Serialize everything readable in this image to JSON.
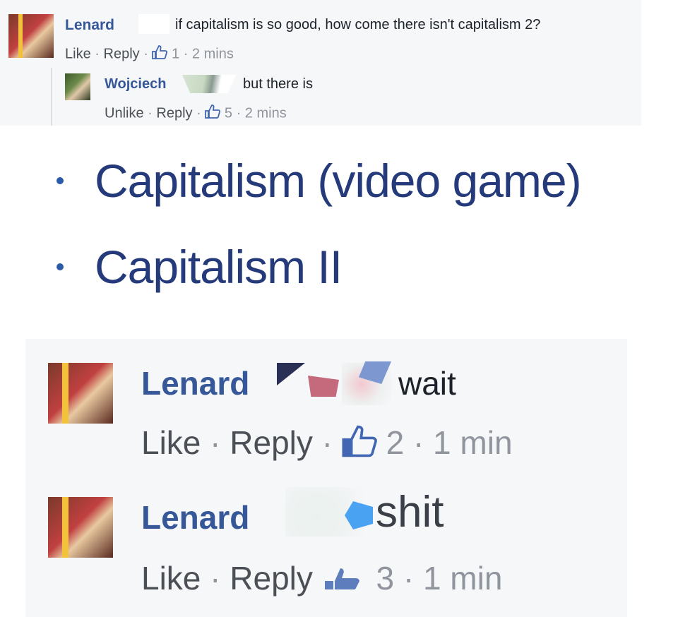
{
  "comment1": {
    "author": "Lenard",
    "text": "if capitalism is so good, how come there isn't capitalism 2?",
    "like": "Like",
    "reply": "Reply",
    "likes": "1",
    "time": "2 mins",
    "sep": "·"
  },
  "reply1": {
    "author": "Wojciech",
    "text": "but there is",
    "like": "Unlike",
    "reply": "Reply",
    "likes": "5",
    "time": "2 mins",
    "sep": "·"
  },
  "wiki": {
    "items": [
      "Capitalism (video game)",
      "Capitalism II"
    ]
  },
  "comment2": {
    "author": "Lenard",
    "text": "wait",
    "like": "Like",
    "reply": "Reply",
    "likes": "2",
    "time": "1 min",
    "sep": "·"
  },
  "comment3": {
    "author": "Lenard",
    "text": "shit",
    "like": "Like",
    "reply": "Reply",
    "likes": "3",
    "time": "1 min",
    "sep": "·"
  },
  "colors": {
    "name": "#365899",
    "text": "#1d2129",
    "meta": "#90949c",
    "panel": "#f6f7f9",
    "wiki_link": "#243a7a"
  },
  "icons": {
    "like": "thumbs-up-icon"
  }
}
